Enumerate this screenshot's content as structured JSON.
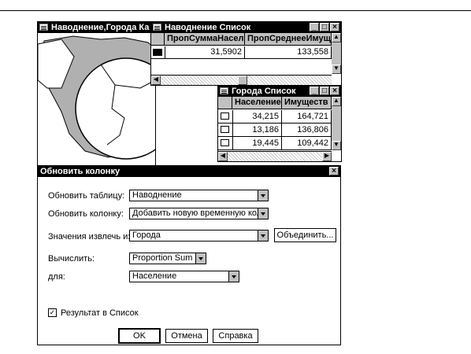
{
  "map_window": {
    "title": "Наводнение,Города Ка"
  },
  "flood_window": {
    "title": "Наводнение Список",
    "columns": [
      "ПропСуммаНасел",
      "ПропСреднееИмущес"
    ],
    "rows": [
      [
        "31,5902",
        "133,558"
      ]
    ]
  },
  "cities_window": {
    "title": "Города Список",
    "columns": [
      "Население",
      "Имуществ"
    ],
    "rows": [
      [
        "34,215",
        "164,721"
      ],
      [
        "13,186",
        "136,806"
      ],
      [
        "19,445",
        "109,442"
      ]
    ]
  },
  "dialog": {
    "title": "Обновить колонку",
    "table_label": "Обновить таблицу:",
    "table_value": "Наводнение",
    "column_label": "Обновить колонку:",
    "column_value": "Добавить новую временную колонк",
    "source_label": "Значения извлечь из:",
    "source_value": "Города",
    "join_button": "Объединить...",
    "calc_label": "Вычислить:",
    "calc_value": "Proportion Sum",
    "for_label": "для:",
    "for_value": "Население",
    "result_checkbox_label": "Результат в Список",
    "result_checked": true,
    "ok_button": "OK",
    "cancel_button": "Отмена",
    "help_button": "Справка"
  }
}
